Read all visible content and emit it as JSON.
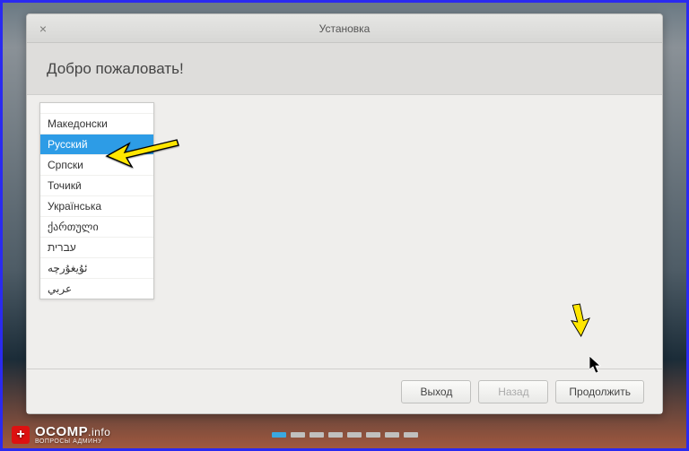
{
  "window": {
    "title": "Установка",
    "close_glyph": "×"
  },
  "header": {
    "welcome": "Добро пожаловать!"
  },
  "languages": {
    "items": [
      {
        "label": "",
        "truncated": true
      },
      {
        "label": "Македонски"
      },
      {
        "label": "Русский",
        "selected": true
      },
      {
        "label": "Српски"
      },
      {
        "label": "Точикӣ"
      },
      {
        "label": "Українська"
      },
      {
        "label": "ქართული"
      },
      {
        "label": "עברית"
      },
      {
        "label": "ئۇيغۇرچە"
      },
      {
        "label": "عربي"
      }
    ]
  },
  "buttons": {
    "exit": "Выход",
    "back": "Назад",
    "continue": "Продолжить"
  },
  "pager": {
    "total": 8,
    "active": 0
  },
  "watermark": {
    "brand": "OCOMP",
    "tld": ".info",
    "subtitle": "ВОПРОСЫ АДМИНУ",
    "badge": "+"
  }
}
